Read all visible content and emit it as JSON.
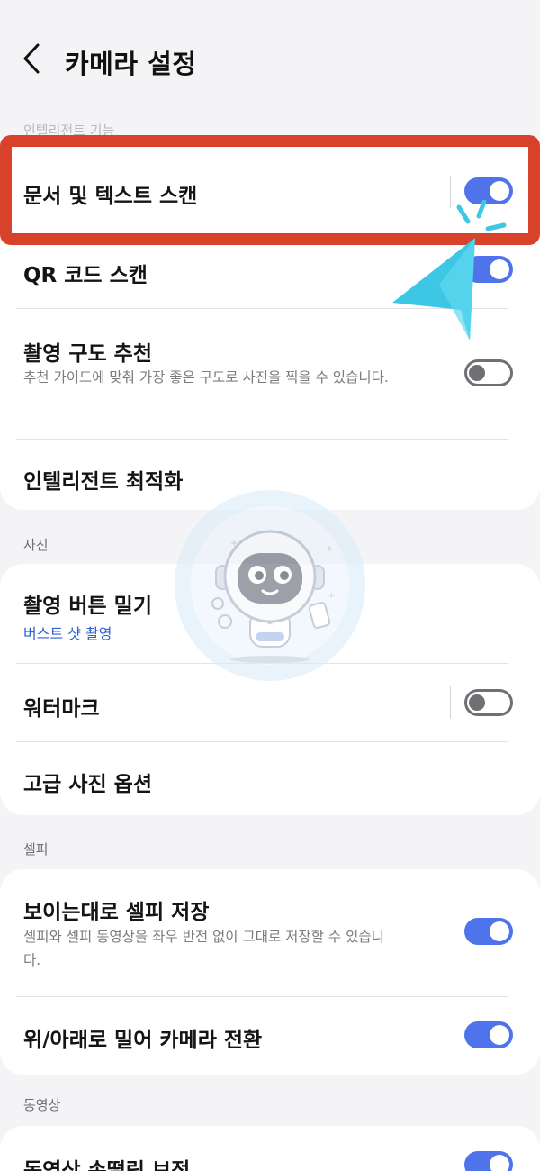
{
  "header": {
    "title": "카메라 설정"
  },
  "sections": {
    "intelligent": {
      "label": "인텔리전트 기능"
    },
    "photo": {
      "label": "사진"
    },
    "selfie": {
      "label": "셀피"
    },
    "video": {
      "label": "동영상"
    }
  },
  "items": {
    "document_scan": {
      "title": "문서 및 텍스트 스캔",
      "toggle": true
    },
    "qr_scan": {
      "title": "QR 코드 스캔",
      "toggle": true
    },
    "shot_suggestions": {
      "title": "촬영 구도 추천",
      "description": "추천 가이드에 맞춰 가장 좋은 구도로 사진을 찍을 수 있습니다.",
      "toggle": false
    },
    "intelligent_optimize": {
      "title": "인텔리전트 최적화"
    },
    "swipe_shutter": {
      "title": "촬영 버튼 밀기",
      "subtitle": "버스트 샷 촬영"
    },
    "watermark": {
      "title": "워터마크",
      "toggle": false
    },
    "advanced_photo": {
      "title": "고급 사진 옵션"
    },
    "save_selfie_as_previewed": {
      "title": "보이는대로 셀피 저장",
      "description": "셀피와 셀피 동영상을 좌우 반전 없이 그대로 저장할 수 있습니다.",
      "toggle": true
    },
    "swipe_switch_camera": {
      "title": "위/아래로 밀어 카메라 전환",
      "toggle": true
    },
    "video_stabilization": {
      "title": "동영상 손떨림 보정",
      "toggle": true
    }
  },
  "colors": {
    "toggle_on": "#4f73ea",
    "highlight": "#d9422a",
    "pointer": "#3ec7e4",
    "subtitle_blue": "#2f5fd6"
  },
  "icons": {
    "back": "chevron-left-icon",
    "pointer": "cursor-pointer-icon",
    "mascot": "robot-mascot-watermark"
  }
}
